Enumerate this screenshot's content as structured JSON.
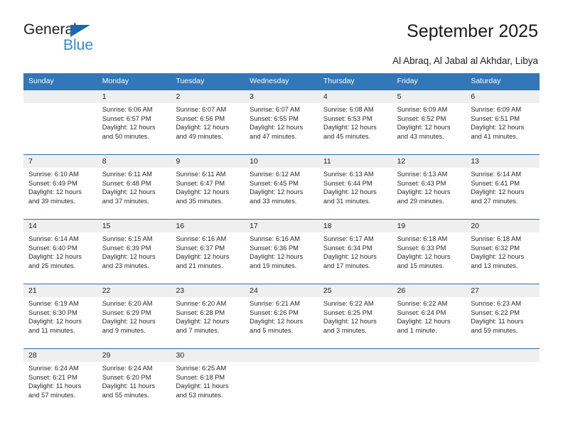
{
  "brand": {
    "name_part1": "General",
    "name_part2": "Blue",
    "triangle_icon": "triangle-icon",
    "color_dark": "#231f20",
    "color_blue": "#2e8bd8",
    "color_triangle": "#1b68b0"
  },
  "header": {
    "title": "September 2025",
    "subtitle": "Al Abraq, Al Jabal al Akhdar, Libya",
    "header_bg": "#3277b8",
    "header_text": "#ffffff",
    "daynum_bg": "#efefef"
  },
  "weekdays": [
    "Sunday",
    "Monday",
    "Tuesday",
    "Wednesday",
    "Thursday",
    "Friday",
    "Saturday"
  ],
  "weeks": [
    [
      {
        "day": "",
        "lines": [
          "",
          "",
          "",
          ""
        ]
      },
      {
        "day": "1",
        "lines": [
          "Sunrise: 6:06 AM",
          "Sunset: 6:57 PM",
          "Daylight: 12 hours",
          "and 50 minutes."
        ]
      },
      {
        "day": "2",
        "lines": [
          "Sunrise: 6:07 AM",
          "Sunset: 6:56 PM",
          "Daylight: 12 hours",
          "and 49 minutes."
        ]
      },
      {
        "day": "3",
        "lines": [
          "Sunrise: 6:07 AM",
          "Sunset: 6:55 PM",
          "Daylight: 12 hours",
          "and 47 minutes."
        ]
      },
      {
        "day": "4",
        "lines": [
          "Sunrise: 6:08 AM",
          "Sunset: 6:53 PM",
          "Daylight: 12 hours",
          "and 45 minutes."
        ]
      },
      {
        "day": "5",
        "lines": [
          "Sunrise: 6:09 AM",
          "Sunset: 6:52 PM",
          "Daylight: 12 hours",
          "and 43 minutes."
        ]
      },
      {
        "day": "6",
        "lines": [
          "Sunrise: 6:09 AM",
          "Sunset: 6:51 PM",
          "Daylight: 12 hours",
          "and 41 minutes."
        ]
      }
    ],
    [
      {
        "day": "7",
        "lines": [
          "Sunrise: 6:10 AM",
          "Sunset: 6:49 PM",
          "Daylight: 12 hours",
          "and 39 minutes."
        ]
      },
      {
        "day": "8",
        "lines": [
          "Sunrise: 6:11 AM",
          "Sunset: 6:48 PM",
          "Daylight: 12 hours",
          "and 37 minutes."
        ]
      },
      {
        "day": "9",
        "lines": [
          "Sunrise: 6:11 AM",
          "Sunset: 6:47 PM",
          "Daylight: 12 hours",
          "and 35 minutes."
        ]
      },
      {
        "day": "10",
        "lines": [
          "Sunrise: 6:12 AM",
          "Sunset: 6:45 PM",
          "Daylight: 12 hours",
          "and 33 minutes."
        ]
      },
      {
        "day": "11",
        "lines": [
          "Sunrise: 6:13 AM",
          "Sunset: 6:44 PM",
          "Daylight: 12 hours",
          "and 31 minutes."
        ]
      },
      {
        "day": "12",
        "lines": [
          "Sunrise: 6:13 AM",
          "Sunset: 6:43 PM",
          "Daylight: 12 hours",
          "and 29 minutes."
        ]
      },
      {
        "day": "13",
        "lines": [
          "Sunrise: 6:14 AM",
          "Sunset: 6:41 PM",
          "Daylight: 12 hours",
          "and 27 minutes."
        ]
      }
    ],
    [
      {
        "day": "14",
        "lines": [
          "Sunrise: 6:14 AM",
          "Sunset: 6:40 PM",
          "Daylight: 12 hours",
          "and 25 minutes."
        ]
      },
      {
        "day": "15",
        "lines": [
          "Sunrise: 6:15 AM",
          "Sunset: 6:39 PM",
          "Daylight: 12 hours",
          "and 23 minutes."
        ]
      },
      {
        "day": "16",
        "lines": [
          "Sunrise: 6:16 AM",
          "Sunset: 6:37 PM",
          "Daylight: 12 hours",
          "and 21 minutes."
        ]
      },
      {
        "day": "17",
        "lines": [
          "Sunrise: 6:16 AM",
          "Sunset: 6:36 PM",
          "Daylight: 12 hours",
          "and 19 minutes."
        ]
      },
      {
        "day": "18",
        "lines": [
          "Sunrise: 6:17 AM",
          "Sunset: 6:34 PM",
          "Daylight: 12 hours",
          "and 17 minutes."
        ]
      },
      {
        "day": "19",
        "lines": [
          "Sunrise: 6:18 AM",
          "Sunset: 6:33 PM",
          "Daylight: 12 hours",
          "and 15 minutes."
        ]
      },
      {
        "day": "20",
        "lines": [
          "Sunrise: 6:18 AM",
          "Sunset: 6:32 PM",
          "Daylight: 12 hours",
          "and 13 minutes."
        ]
      }
    ],
    [
      {
        "day": "21",
        "lines": [
          "Sunrise: 6:19 AM",
          "Sunset: 6:30 PM",
          "Daylight: 12 hours",
          "and 11 minutes."
        ]
      },
      {
        "day": "22",
        "lines": [
          "Sunrise: 6:20 AM",
          "Sunset: 6:29 PM",
          "Daylight: 12 hours",
          "and 9 minutes."
        ]
      },
      {
        "day": "23",
        "lines": [
          "Sunrise: 6:20 AM",
          "Sunset: 6:28 PM",
          "Daylight: 12 hours",
          "and 7 minutes."
        ]
      },
      {
        "day": "24",
        "lines": [
          "Sunrise: 6:21 AM",
          "Sunset: 6:26 PM",
          "Daylight: 12 hours",
          "and 5 minutes."
        ]
      },
      {
        "day": "25",
        "lines": [
          "Sunrise: 6:22 AM",
          "Sunset: 6:25 PM",
          "Daylight: 12 hours",
          "and 3 minutes."
        ]
      },
      {
        "day": "26",
        "lines": [
          "Sunrise: 6:22 AM",
          "Sunset: 6:24 PM",
          "Daylight: 12 hours",
          "and 1 minute."
        ]
      },
      {
        "day": "27",
        "lines": [
          "Sunrise: 6:23 AM",
          "Sunset: 6:22 PM",
          "Daylight: 11 hours",
          "and 59 minutes."
        ]
      }
    ],
    [
      {
        "day": "28",
        "lines": [
          "Sunrise: 6:24 AM",
          "Sunset: 6:21 PM",
          "Daylight: 11 hours",
          "and 57 minutes."
        ]
      },
      {
        "day": "29",
        "lines": [
          "Sunrise: 6:24 AM",
          "Sunset: 6:20 PM",
          "Daylight: 11 hours",
          "and 55 minutes."
        ]
      },
      {
        "day": "30",
        "lines": [
          "Sunrise: 6:25 AM",
          "Sunset: 6:18 PM",
          "Daylight: 11 hours",
          "and 53 minutes."
        ]
      },
      {
        "day": "",
        "lines": [
          "",
          "",
          "",
          ""
        ]
      },
      {
        "day": "",
        "lines": [
          "",
          "",
          "",
          ""
        ]
      },
      {
        "day": "",
        "lines": [
          "",
          "",
          "",
          ""
        ]
      },
      {
        "day": "",
        "lines": [
          "",
          "",
          "",
          ""
        ]
      }
    ]
  ]
}
